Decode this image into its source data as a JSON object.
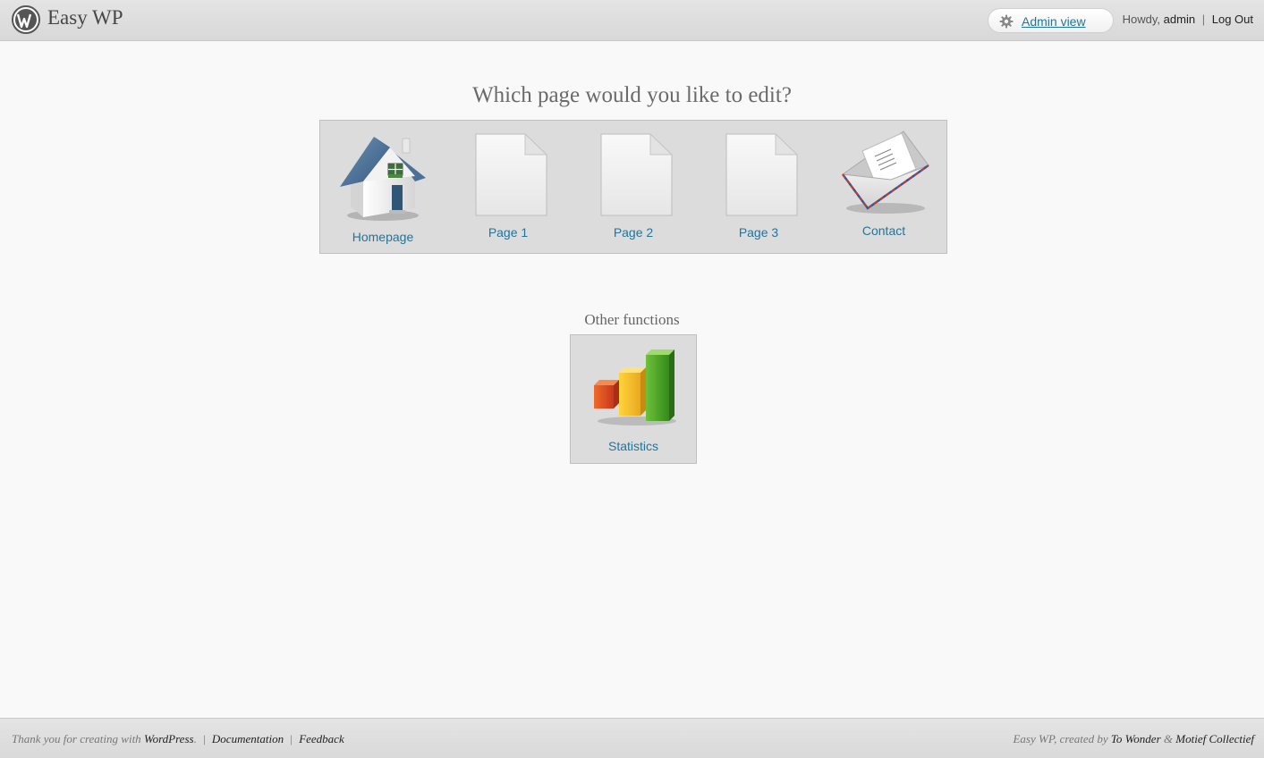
{
  "header": {
    "site_title": "Easy WP",
    "logo_icon": "wordpress-logo-icon",
    "admin_view_label": "Admin view",
    "admin_view_icon": "gear-icon",
    "howdy": "Howdy,",
    "username": "admin",
    "separator": "|",
    "logout": "Log Out"
  },
  "main": {
    "heading": "Which page would you like to edit?",
    "pages": [
      {
        "label": "Homepage",
        "icon": "house-icon"
      },
      {
        "label": "Page 1",
        "icon": "blank-page-icon"
      },
      {
        "label": "Page 2",
        "icon": "blank-page-icon"
      },
      {
        "label": "Page 3",
        "icon": "blank-page-icon"
      },
      {
        "label": "Contact",
        "icon": "envelope-icon"
      }
    ],
    "other_heading": "Other functions",
    "other": [
      {
        "label": "Statistics",
        "icon": "bar-chart-icon"
      }
    ]
  },
  "footer": {
    "thanks": "Thank you for creating with",
    "wordpress": "WordPress",
    "period": ".",
    "separator": "|",
    "documentation": "Documentation",
    "feedback": "Feedback",
    "credit_prefix": "Easy WP, created by",
    "author1": "To Wonder",
    "amp": "&",
    "author2": "Motief Collectief"
  },
  "colors": {
    "link": "#21759b",
    "panel_bg": "#dcdcdc",
    "page_bg": "#f9f9f9"
  }
}
